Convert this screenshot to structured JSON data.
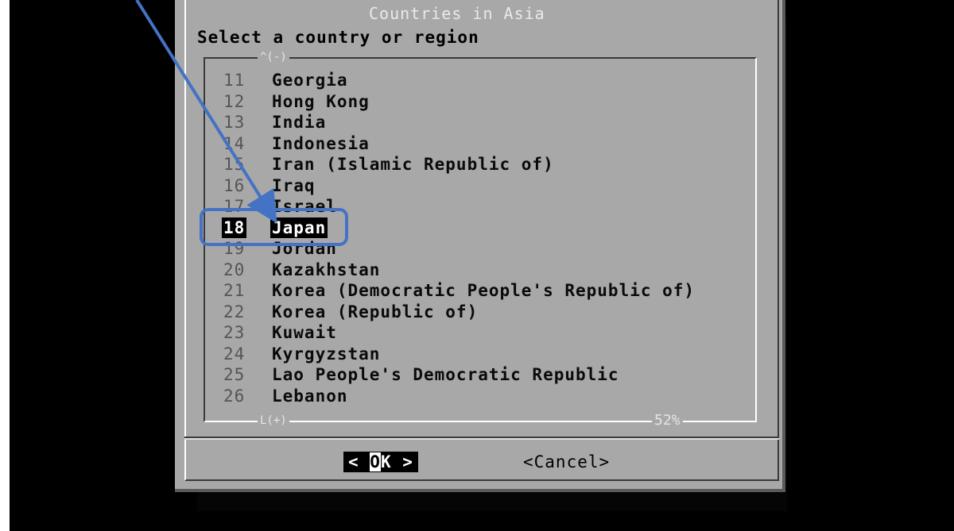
{
  "dialog": {
    "title": "Countries in Asia",
    "prompt": "Select a country or region",
    "scroll_up": "^(-)",
    "scroll_down": "L(+)",
    "percent": "52%"
  },
  "list": {
    "items": [
      {
        "num": "11",
        "name": "Georgia"
      },
      {
        "num": "12",
        "name": "Hong Kong"
      },
      {
        "num": "13",
        "name": "India"
      },
      {
        "num": "14",
        "name": "Indonesia"
      },
      {
        "num": "15",
        "name": "Iran (Islamic Republic of)"
      },
      {
        "num": "16",
        "name": "Iraq"
      },
      {
        "num": "17",
        "name": "Israel"
      },
      {
        "num": "18",
        "name": "Japan"
      },
      {
        "num": "19",
        "name": "Jordan"
      },
      {
        "num": "20",
        "name": "Kazakhstan"
      },
      {
        "num": "21",
        "name": "Korea (Democratic People's Republic of)"
      },
      {
        "num": "22",
        "name": "Korea (Republic of)"
      },
      {
        "num": "23",
        "name": "Kuwait"
      },
      {
        "num": "24",
        "name": "Kyrgyzstan"
      },
      {
        "num": "25",
        "name": "Lao People's Democratic Republic"
      },
      {
        "num": "26",
        "name": "Lebanon"
      }
    ],
    "selected_index": 7
  },
  "buttons": {
    "ok_left": "< ",
    "ok_cursor": "O",
    "ok_rest": "K",
    "ok_right": " >",
    "cancel": "<Cancel>"
  },
  "annotation": {
    "color": "#4472C4"
  }
}
